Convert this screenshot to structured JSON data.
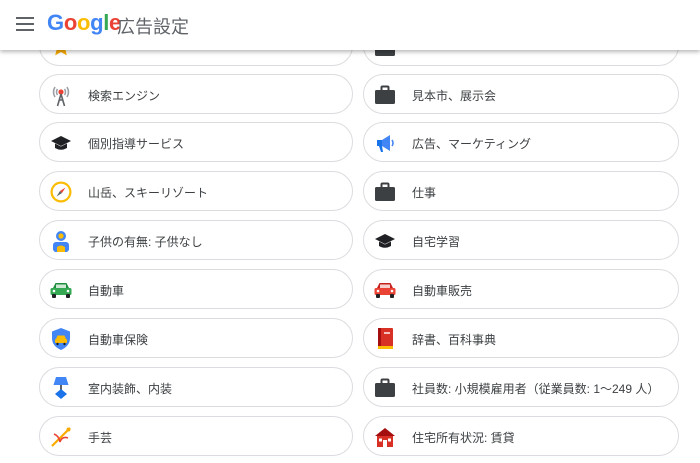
{
  "header": {
    "logo_text": "Google",
    "product_name": "広告設定"
  },
  "left_items": [
    {
      "label": "",
      "icon": "star-icon"
    },
    {
      "label": "検索エンジン",
      "icon": "antenna-icon"
    },
    {
      "label": "個別指導サービス",
      "icon": "graduation-cap-icon"
    },
    {
      "label": "山岳、スキーリゾート",
      "icon": "compass-icon"
    },
    {
      "label": "子供の有無: 子供なし",
      "icon": "person-badge-icon"
    },
    {
      "label": "自動車",
      "icon": "car-icon"
    },
    {
      "label": "自動車保険",
      "icon": "car-shield-icon"
    },
    {
      "label": "室内装飾、内装",
      "icon": "lamp-icon"
    },
    {
      "label": "手芸",
      "icon": "sewing-needle-icon"
    }
  ],
  "right_items": [
    {
      "label": "",
      "icon": "briefcase-icon"
    },
    {
      "label": "見本市、展示会",
      "icon": "briefcase-icon"
    },
    {
      "label": "広告、マーケティング",
      "icon": "megaphone-icon"
    },
    {
      "label": "仕事",
      "icon": "briefcase-icon"
    },
    {
      "label": "自宅学習",
      "icon": "graduation-cap-icon"
    },
    {
      "label": "自動車販売",
      "icon": "car-icon"
    },
    {
      "label": "辞書、百科事典",
      "icon": "book-icon"
    },
    {
      "label": "社員数: 小規模雇用者（従業員数: 1～249 人）",
      "icon": "briefcase-icon"
    },
    {
      "label": "住宅所有状況: 賃貸",
      "icon": "house-icon"
    }
  ],
  "colors": {
    "google_blue": "#4285F4",
    "google_red": "#EA4335",
    "google_yellow": "#FBBC05",
    "google_green": "#34A853",
    "icon_dark": "#5f6368",
    "border": "#dadce0"
  }
}
